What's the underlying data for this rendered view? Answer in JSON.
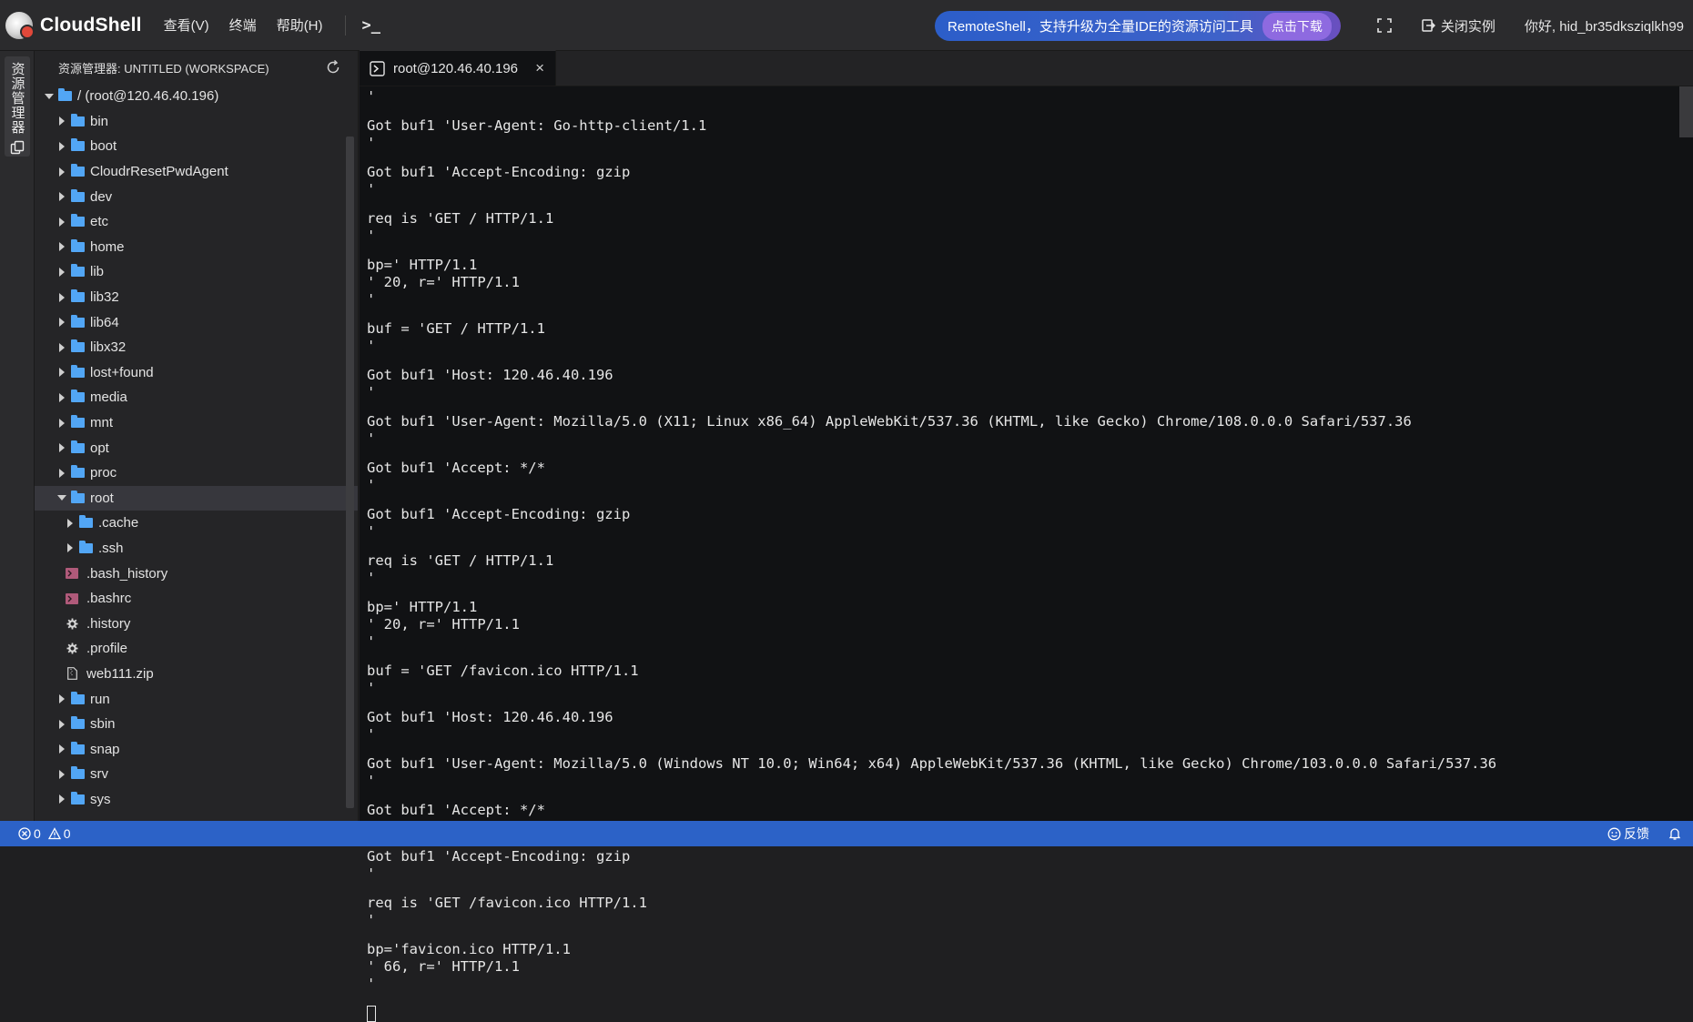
{
  "app": {
    "name": "CloudShell",
    "menu": [
      "查看(V)",
      "终端",
      "帮助(H)"
    ],
    "terminal_symbol": ">_"
  },
  "promo": {
    "text": "RemoteShell，支持升级为全量IDE的资源访问工具",
    "button": "点击下载"
  },
  "header_right": {
    "exit_label": "关闭实例",
    "greeting": "你好, hid_br35dksziqlkh99"
  },
  "activity_bar": {
    "explorer_label": "资源管理器"
  },
  "explorer": {
    "title": "资源管理器: UNTITLED (WORKSPACE)",
    "root_label": "/ (root@120.46.40.196)",
    "items": [
      {
        "label": "bin",
        "type": "folder",
        "depth": 1
      },
      {
        "label": "boot",
        "type": "folder",
        "depth": 1
      },
      {
        "label": "CloudrResetPwdAgent",
        "type": "folder",
        "depth": 1
      },
      {
        "label": "dev",
        "type": "folder",
        "depth": 1
      },
      {
        "label": "etc",
        "type": "folder",
        "depth": 1
      },
      {
        "label": "home",
        "type": "folder",
        "depth": 1
      },
      {
        "label": "lib",
        "type": "folder",
        "depth": 1
      },
      {
        "label": "lib32",
        "type": "folder",
        "depth": 1
      },
      {
        "label": "lib64",
        "type": "folder",
        "depth": 1
      },
      {
        "label": "libx32",
        "type": "folder",
        "depth": 1
      },
      {
        "label": "lost+found",
        "type": "folder",
        "depth": 1
      },
      {
        "label": "media",
        "type": "folder",
        "depth": 1
      },
      {
        "label": "mnt",
        "type": "folder",
        "depth": 1
      },
      {
        "label": "opt",
        "type": "folder",
        "depth": 1
      },
      {
        "label": "proc",
        "type": "folder",
        "depth": 1
      },
      {
        "label": "root",
        "type": "folder-open",
        "depth": 1,
        "selected": true
      },
      {
        "label": ".cache",
        "type": "folder",
        "depth": 2
      },
      {
        "label": ".ssh",
        "type": "folder",
        "depth": 2
      },
      {
        "label": ".bash_history",
        "type": "shell-file",
        "depth": 2
      },
      {
        "label": ".bashrc",
        "type": "shell-file",
        "depth": 2
      },
      {
        "label": ".history",
        "type": "gear-file",
        "depth": 2
      },
      {
        "label": ".profile",
        "type": "gear-file",
        "depth": 2
      },
      {
        "label": "web111.zip",
        "type": "zip-file",
        "depth": 2
      },
      {
        "label": "run",
        "type": "folder",
        "depth": 1
      },
      {
        "label": "sbin",
        "type": "folder",
        "depth": 1
      },
      {
        "label": "snap",
        "type": "folder",
        "depth": 1
      },
      {
        "label": "srv",
        "type": "folder",
        "depth": 1
      },
      {
        "label": "sys",
        "type": "folder",
        "depth": 1
      }
    ]
  },
  "tab": {
    "label": "root@120.46.40.196",
    "close": "×"
  },
  "terminal": {
    "lines": [
      "'",
      "Got buf1 'User-Agent: Go-http-client/1.1",
      "'",
      "Got buf1 'Accept-Encoding: gzip",
      "'",
      "req is 'GET / HTTP/1.1",
      "'",
      "bp=' HTTP/1.1",
      "' 20, r=' HTTP/1.1",
      "'",
      "buf = 'GET / HTTP/1.1",
      "'",
      "Got buf1 'Host: 120.46.40.196",
      "'",
      "Got buf1 'User-Agent: Mozilla/5.0 (X11; Linux x86_64) AppleWebKit/537.36 (KHTML, like Gecko) Chrome/108.0.0.0 Safari/537.36",
      "'",
      "Got buf1 'Accept: */*",
      "'",
      "Got buf1 'Accept-Encoding: gzip",
      "'",
      "req is 'GET / HTTP/1.1",
      "'",
      "bp=' HTTP/1.1",
      "' 20, r=' HTTP/1.1",
      "'",
      "buf = 'GET /favicon.ico HTTP/1.1",
      "'",
      "Got buf1 'Host: 120.46.40.196",
      "'",
      "Got buf1 'User-Agent: Mozilla/5.0 (Windows NT 10.0; Win64; x64) AppleWebKit/537.36 (KHTML, like Gecko) Chrome/103.0.0.0 Safari/537.36",
      "'",
      "Got buf1 'Accept: */*",
      "'",
      "Got buf1 'Accept-Encoding: gzip",
      "'",
      "req is 'GET /favicon.ico HTTP/1.1",
      "'",
      "bp='favicon.ico HTTP/1.1",
      "' 66, r=' HTTP/1.1",
      "'"
    ]
  },
  "statusbar": {
    "errors": "0",
    "warnings": "0",
    "feedback": "反馈"
  },
  "colors": {
    "accent": "#2c62c7",
    "folder": "#52a6f5",
    "terminal_bg": "#111214"
  }
}
